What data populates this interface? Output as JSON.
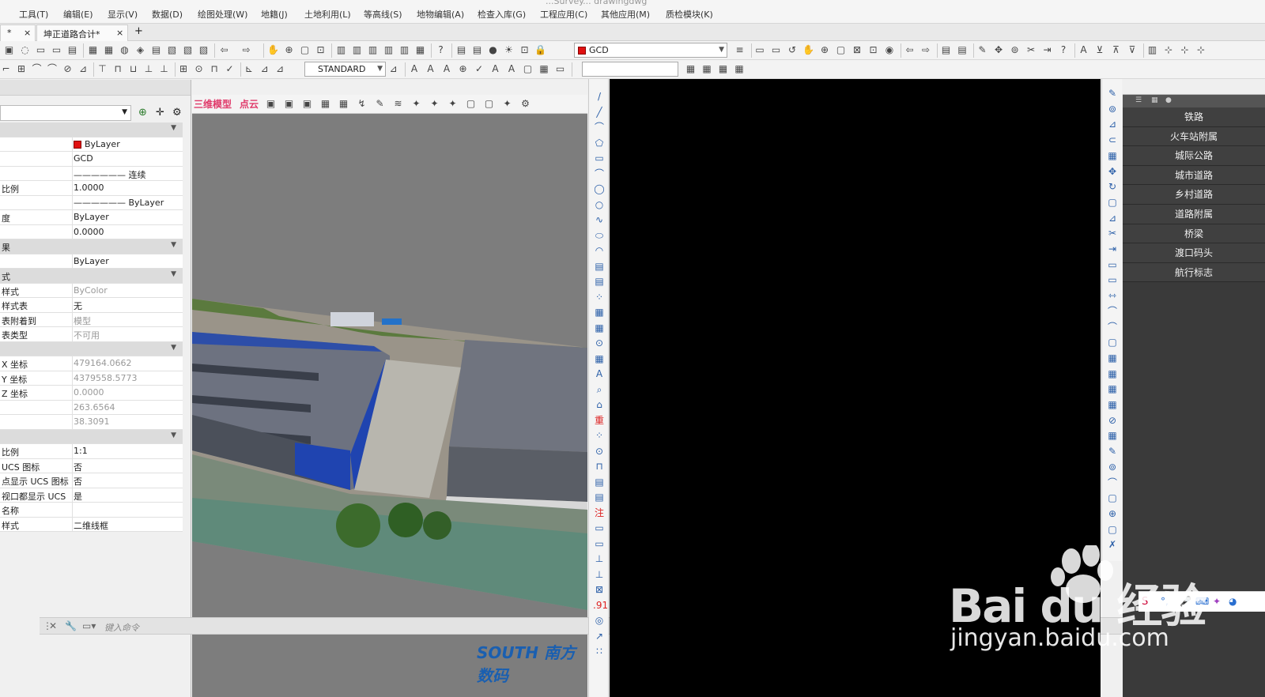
{
  "window": {
    "title": "...Survey... drawingdwg"
  },
  "menu": [
    "工具(T)",
    "编辑(E)",
    "显示(V)",
    "数据(D)",
    "绘图处理(W)",
    "地籍(J)",
    "土地利用(L)",
    "等高线(S)",
    "地物编辑(A)",
    "检查入库(G)",
    "工程应用(C)",
    "其他应用(M)",
    "质检模块(K)"
  ],
  "tabs": [
    {
      "label": "*",
      "close": "×"
    },
    {
      "label": "坤正道路合计*",
      "close": "×"
    },
    {
      "label": "+"
    }
  ],
  "toolbar1": {
    "layer_value": "GCD"
  },
  "toolbar2": {
    "text_style": "STANDARD"
  },
  "properties": {
    "rows": [
      {
        "type": "section"
      },
      {
        "key": "",
        "value": "ByLayer",
        "swatch": true
      },
      {
        "key": "",
        "value": "GCD"
      },
      {
        "key": "",
        "value": "—————— 连续"
      },
      {
        "key": "比例",
        "value": "1.0000"
      },
      {
        "key": "",
        "value": "—————— ByLayer"
      },
      {
        "key": "度",
        "value": "ByLayer"
      },
      {
        "key": "",
        "value": "0.0000"
      },
      {
        "key": "果",
        "type": "section"
      },
      {
        "key": "",
        "value": "ByLayer"
      },
      {
        "key": "式",
        "type": "section"
      },
      {
        "key": "样式",
        "value": "ByColor",
        "gray": true
      },
      {
        "key": "样式表",
        "value": "无"
      },
      {
        "key": "表附着到",
        "value": "模型",
        "gray": true
      },
      {
        "key": "表类型",
        "value": "不可用",
        "gray": true
      },
      {
        "type": "section"
      },
      {
        "key": "X 坐标",
        "value": "479164.0662",
        "gray": true
      },
      {
        "key": "Y 坐标",
        "value": "4379558.5773",
        "gray": true
      },
      {
        "key": "Z 坐标",
        "value": "0.0000",
        "gray": true
      },
      {
        "key": "",
        "value": "263.6564",
        "gray": true
      },
      {
        "key": "",
        "value": "38.3091",
        "gray": true
      },
      {
        "type": "section"
      },
      {
        "key": "比例",
        "value": "1:1"
      },
      {
        "key": "UCS 图标",
        "value": "否"
      },
      {
        "key": "点显示 UCS 图标",
        "value": "否"
      },
      {
        "key": "视口都显示 UCS",
        "value": "是"
      },
      {
        "key": "名称",
        "value": ""
      },
      {
        "key": "样式",
        "value": "二维线框"
      }
    ]
  },
  "viewport3d": {
    "label_1": "三维模型",
    "label_2": "点云",
    "logo": "SOUTH 南方数码"
  },
  "command_line": {
    "placeholder": "键入命令"
  },
  "categories": [
    "铁路",
    "火车站附属",
    "城际公路",
    "城市道路",
    "乡村道路",
    "道路附属",
    "桥梁",
    "渡口码头",
    "航行标志"
  ],
  "watermark": {
    "brand": "Bai du 经验",
    "url": "jingyan.baidu.com"
  },
  "colors": {
    "accent_pink": "#e03a6a",
    "panel_dark": "#404040",
    "layer_red": "#e01010"
  }
}
